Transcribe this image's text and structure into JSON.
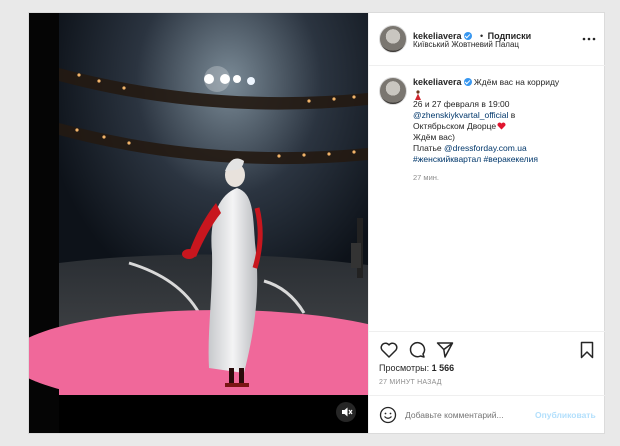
{
  "header": {
    "username": "kekeliavera",
    "follow_label": "Подписки",
    "location": "Київський Жовтневий Палац",
    "more_icon": "more-horizontal-icon"
  },
  "caption": {
    "username": "kekeliavera",
    "line1": "Ждём вас на корриду",
    "emoji_icon": "dancer-emoji-icon",
    "line2": "26 и 27 февраля в 19:00",
    "mention": "@zhenskiykvartal_official",
    "line3_suffix": " в",
    "line4": "Октябрьском Дворце",
    "heart_icon": "red-heart-emoji-icon",
    "line5": "Ждём вас)",
    "line6_prefix": "Платье ",
    "line6_mention": "@dressforday.com.ua",
    "hashtags": "#женскийквартал #веракекелия",
    "time": "27 мин."
  },
  "actions": {
    "like_icon": "heart-icon",
    "comment_icon": "comment-icon",
    "share_icon": "send-icon",
    "save_icon": "bookmark-icon"
  },
  "views": {
    "label": "Просмотры:",
    "count": "1 566"
  },
  "timestamp": "27 МИНУТ НАЗАД",
  "comment": {
    "emoji_icon": "smiley-icon",
    "placeholder": "Добавьте комментарий...",
    "post_label": "Опубликовать"
  },
  "media": {
    "mute_icon": "mute-icon"
  },
  "colors": {
    "accent": "#3897f0",
    "pink_floor": "#f0689a",
    "dress_red": "#c8161e"
  }
}
